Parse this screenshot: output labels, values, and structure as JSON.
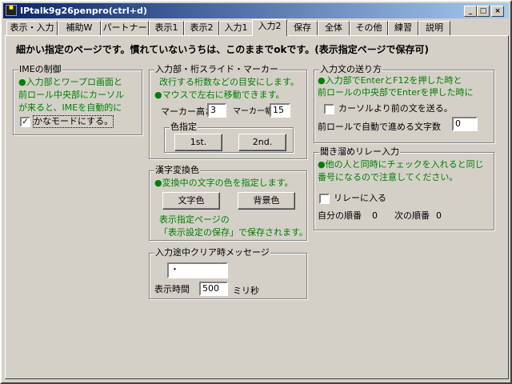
{
  "window": {
    "title": "IPtalk9g26penpro(ctrl+d)",
    "minimize": "_",
    "maximize": "□",
    "close": "×"
  },
  "tabs": [
    "表示・入力",
    "補助W",
    "パートナー",
    "表示1",
    "表示2",
    "入力1",
    "入力2",
    "保存",
    "全体",
    "その他",
    "練習",
    "説明"
  ],
  "active_tab": "入力2",
  "heading": "細かい指定のページです。慣れていないうちは、このままでokです。(表示指定ページで保存可)",
  "ime": {
    "title": "IMEの制御",
    "line1": "●入力部とワープロ画面と",
    "line2": "前ロール中央部にカーソル",
    "line3": "が来ると、IMEを自動的に",
    "kana_mode_label": "かなモードにする。",
    "kana_mode_checked": "✓"
  },
  "marker": {
    "title": "入力部・桁スライド・マーカー",
    "line1": "改行する桁数などの目安にします。",
    "line2": "●マウスで左右に移動できます。",
    "height_label": "マーカー高さ",
    "height_value": "3",
    "width_label": "マーカー幅",
    "width_value": "15",
    "color_title": "色指定",
    "btn_1st": "1st.",
    "btn_2nd": "2nd."
  },
  "kanji": {
    "title": "漢字変換色",
    "line1": "●変換中の文字の色を指定します。",
    "text_color_button": "文字色",
    "bg_color_button": "背景色",
    "note1": "表示指定ページの",
    "note2": "「表示設定の保存」で保存されます。"
  },
  "clear_msg": {
    "title": "入力途中クリア時メッセージ",
    "message_value": "・",
    "time_label": "表示時間",
    "time_value": "500",
    "unit": "ミリ秒"
  },
  "send": {
    "title": "入力文の送り方",
    "line1": "●入力部でEnterとF12を押した時と",
    "line2": "前ロールの中央部でEnterを押した時に",
    "before_cursor_label": "カーソルより前の文を送る。",
    "auto_advance_label": "前ロールで自動で進める文字数",
    "auto_advance_value": "0"
  },
  "relay": {
    "title": "聞き溜めリレー入力",
    "line1": "●他の人と同時にチェックを入れると同じ",
    "line2": "番号になるので注意してください。",
    "join_label": "リレーに入る",
    "my_order_label": "自分の順番",
    "my_order_value": "0",
    "next_order_label": "次の順番",
    "next_order_value": "0"
  },
  "colors": {
    "face": "#d4d0c8",
    "title_start": "#0a246a",
    "title_end": "#a6caf0",
    "green_text": "#008000"
  }
}
